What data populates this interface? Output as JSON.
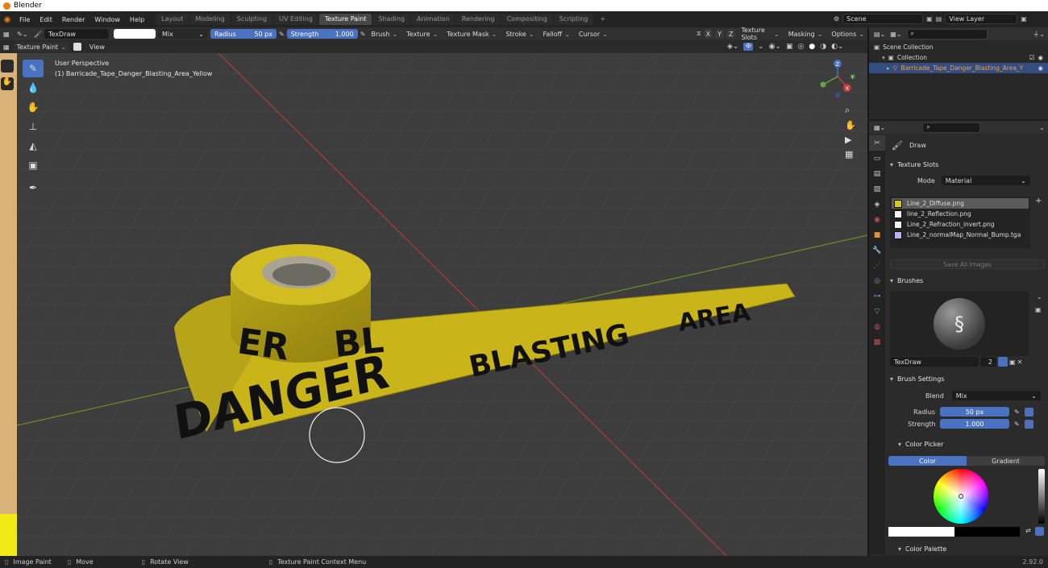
{
  "title": "Blender",
  "menu": [
    "File",
    "Edit",
    "Render",
    "Window",
    "Help"
  ],
  "workspaces": [
    {
      "label": "Layout",
      "active": false
    },
    {
      "label": "Modeling",
      "active": false
    },
    {
      "label": "Sculpting",
      "active": false
    },
    {
      "label": "UV Editing",
      "active": false
    },
    {
      "label": "Texture Paint",
      "active": true
    },
    {
      "label": "Shading",
      "active": false
    },
    {
      "label": "Animation",
      "active": false
    },
    {
      "label": "Rendering",
      "active": false
    },
    {
      "label": "Compositing",
      "active": false
    },
    {
      "label": "Scripting",
      "active": false
    }
  ],
  "add_workspace": "+",
  "scene": "Scene",
  "view_layer": "View Layer",
  "toolbar": {
    "brush_name": "TexDraw",
    "blend": "Mix",
    "radius_label": "Radius",
    "radius_value": "50 px",
    "strength_label": "Strength",
    "strength_value": "1.000",
    "menus": [
      "Brush",
      "Texture",
      "Texture Mask",
      "Stroke",
      "Falloff",
      "Cursor"
    ],
    "axes": [
      "X",
      "Y",
      "Z"
    ],
    "right_menus": [
      "Texture Slots",
      "Masking",
      "Options"
    ]
  },
  "header2": {
    "mode": "Texture Paint",
    "view": "View"
  },
  "viewport": {
    "perspective": "User Perspective",
    "object": "(1) Barricade_Tape_Danger_Blasting_Area_Yellow",
    "tape_words": [
      "DANGER",
      "BLASTING",
      "AREA"
    ],
    "roll_words": [
      "ER",
      "BL"
    ],
    "gizmo_axes": [
      "Z",
      "X",
      "Y"
    ]
  },
  "outliner": {
    "scene_collection": "Scene Collection",
    "collection": "Collection",
    "object": "Barricade_Tape_Danger_Blasting_Area_Y"
  },
  "properties": {
    "tool_name": "Draw",
    "texture_slots_title": "Texture Slots",
    "mode_label": "Mode",
    "mode_value": "Material",
    "slots": [
      {
        "name": "Line_2_Diffuse.png",
        "color": "#d9c21e",
        "selected": true
      },
      {
        "name": "line_2_Reflection.png",
        "color": "#f2f2f2",
        "selected": false
      },
      {
        "name": "Line_2_Refraction_invert.png",
        "color": "#f2f2f2",
        "selected": false
      },
      {
        "name": "Line_2_normalMap_Normal_Bump.tga",
        "color": "#b9b0ee",
        "selected": false
      }
    ],
    "save_all": "Save All Images",
    "brushes_title": "Brushes",
    "brush_name": "TexDraw",
    "brush_users": "2",
    "brush_settings_title": "Brush Settings",
    "blend_label": "Blend",
    "blend_value": "Mix",
    "radius_label": "Radius",
    "radius_value": "50 px",
    "strength_label": "Strength",
    "strength_value": "1.000",
    "color_picker_title": "Color Picker",
    "color_tab": "Color",
    "gradient_tab": "Gradient",
    "color_palette_title": "Color Palette"
  },
  "status": {
    "left": "Image Paint",
    "move": "Move",
    "rotate": "Rotate View",
    "context": "Texture Paint Context Menu",
    "version": "2.92.0"
  },
  "colors": {
    "accent": "#4a72c0",
    "tape": "#c9b51a",
    "header": "#303030"
  }
}
